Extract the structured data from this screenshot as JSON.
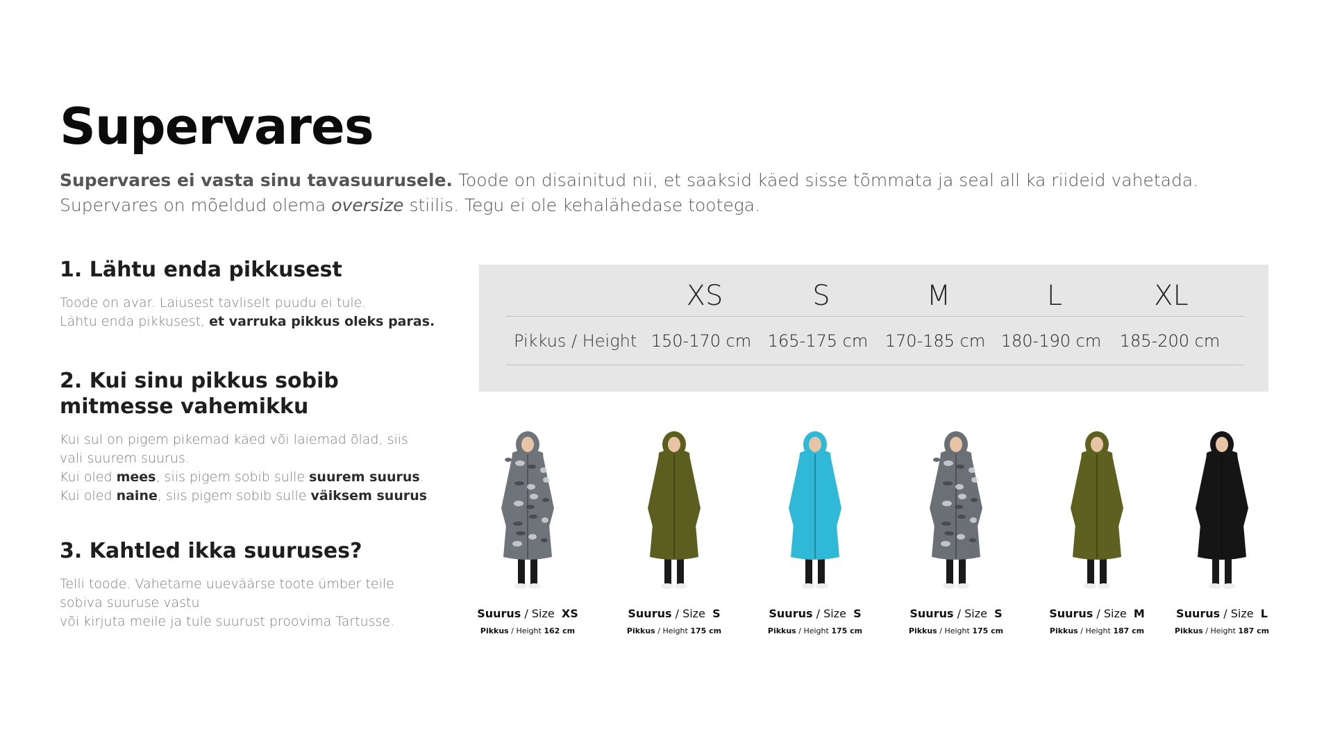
{
  "title": "Supervares",
  "intro": {
    "bold": "Supervares ei vasta sinu tavasuurusele.",
    "rest1": " Toode on disainitud nii, et saaksid käed sisse tõmmata ja seal all ka riideid vahetada.",
    "line2a": "Supervares on mõeldud olema ",
    "line2i": "oversize",
    "line2b": " stiilis. Tegu ei ole kehalähedase tootega."
  },
  "steps": [
    {
      "title": "1. Lähtu enda pikkusest",
      "line1": "Toode on avar. Laiusest tavliselt puudu ei tule.",
      "line2a": "Lähtu enda pikkusest, ",
      "line2b": "et varruka pikkus oleks paras."
    },
    {
      "title_l1": "2. Kui sinu pikkus sobib",
      "title_l2": "mitmesse vahemikku",
      "line1": "Kui sul on pigem pikemad käed või laiemad õlad, siis vali suurem suurus.",
      "a1": "Kui oled ",
      "a2": "mees",
      "a3": ", siis pigem sobib sulle ",
      "a4": "suurem suurus",
      "a5": ".",
      "b1": "Kui oled ",
      "b2": "naine",
      "b3": ", siis pigem sobib sulle ",
      "b4": "väiksem suurus",
      "b5": "."
    },
    {
      "title": "3. Kahtled ikka suuruses?",
      "line1": "Telli toode. Vahetame uueväärse toote ümber teile sobiva suuruse vastu",
      "line2": "või kirjuta meile ja tule suurust proovima Tartusse."
    }
  ],
  "size_table": {
    "row_label": "Pikkus / Height",
    "sizes": [
      "XS",
      "S",
      "M",
      "L",
      "XL"
    ],
    "heights": [
      "150-170 cm",
      "165-175 cm",
      "170-185 cm",
      "180-190 cm",
      "185-200 cm"
    ]
  },
  "models": [
    {
      "size_word": "Suurus",
      "size_en": "Size",
      "size": "XS",
      "h_word": "Pikkus",
      "h_en": "Height",
      "height": "162 cm",
      "coat_color": "#6f747a",
      "pattern": true
    },
    {
      "size_word": "Suurus",
      "size_en": "Size",
      "size": "S",
      "h_word": "Pikkus",
      "h_en": "Height",
      "height": "175 cm",
      "coat_color": "#5b5e1f",
      "pattern": false
    },
    {
      "size_word": "Suurus",
      "size_en": "Size",
      "size": "S",
      "h_word": "Pikkus",
      "h_en": "Height",
      "height": "175 cm",
      "coat_color": "#2fb9d6",
      "pattern": false
    },
    {
      "size_word": "Suurus",
      "size_en": "Size",
      "size": "S",
      "h_word": "Pikkus",
      "h_en": "Height",
      "height": "175 cm",
      "coat_color": "#6b7077",
      "pattern": true
    },
    {
      "size_word": "Suurus",
      "size_en": "Size",
      "size": "M",
      "h_word": "Pikkus",
      "h_en": "Height",
      "height": "187 cm",
      "coat_color": "#5d601f",
      "pattern": false
    },
    {
      "size_word": "Suurus",
      "size_en": "Size",
      "size": "L",
      "h_word": "Pikkus",
      "h_en": "Height",
      "height": "187 cm",
      "coat_color": "#151515",
      "pattern": false
    }
  ]
}
